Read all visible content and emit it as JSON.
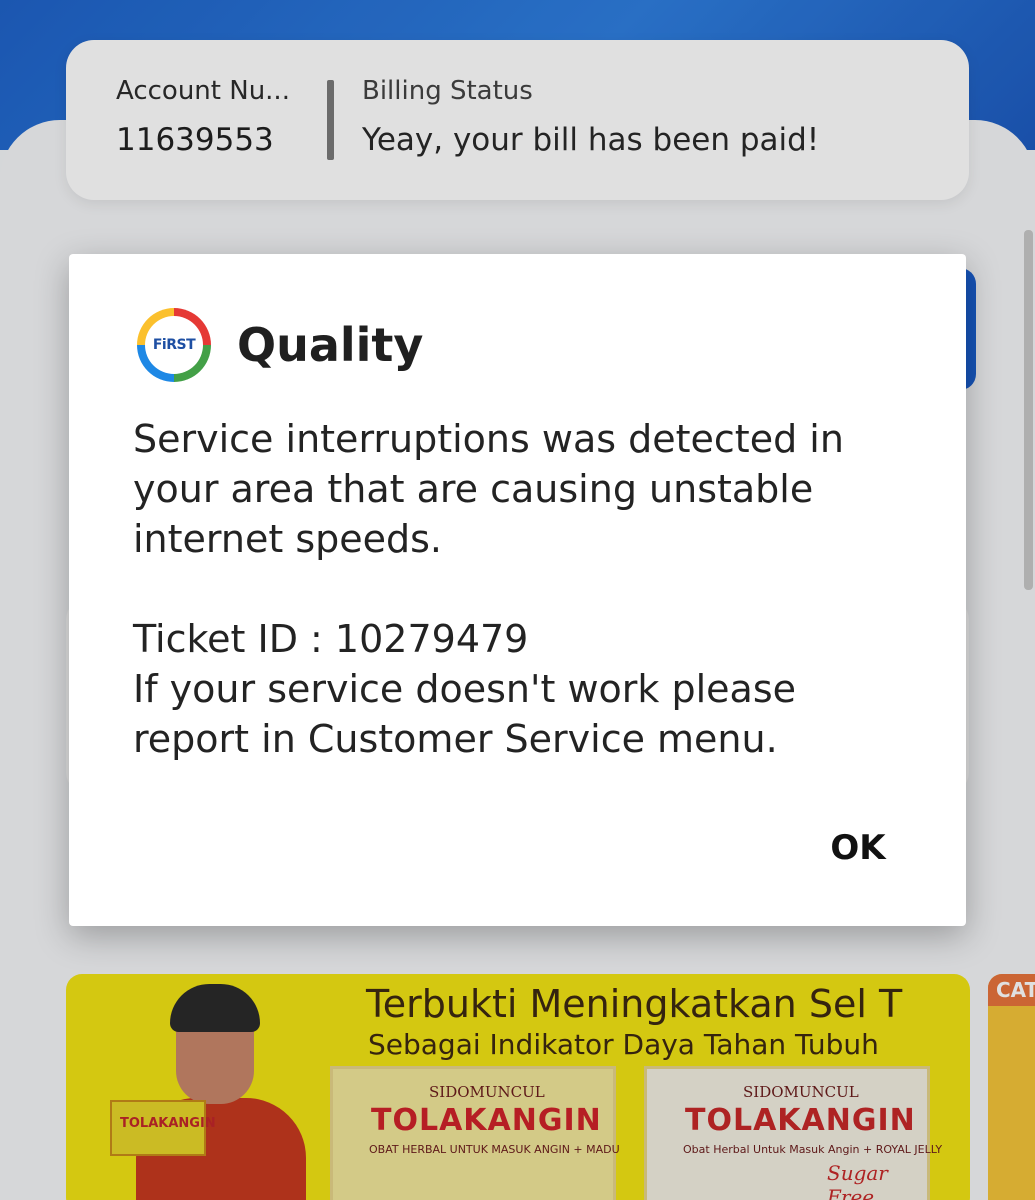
{
  "account": {
    "number_label": "Account Nu...",
    "number_value": "11639553",
    "billing_label": "Billing Status",
    "billing_value": "Yeay, your bill has been paid!"
  },
  "dialog": {
    "logo_text": "FiRST",
    "title": "Quality",
    "message": "Service interruptions was detected in your area that are causing unstable internet speeds.\n\nTicket ID : 10279479\nIf your service doesn't work please report in Customer Service menu.",
    "ok_label": "OK"
  },
  "banner": {
    "title": "Terbukti Meningkatkan Sel T",
    "subtitle": "Sebagai Indikator Daya Tahan Tubuh",
    "pack1": {
      "brand": "SIDOMUNCUL",
      "name": "TOLAKANGIN",
      "desc": "OBAT HERBAL UNTUK MASUK ANGIN + MADU"
    },
    "pack2": {
      "brand": "SIDOMUNCUL",
      "name": "TOLAKANGIN",
      "desc": "Obat Herbal Untuk Masuk Angin + ROYAL JELLY",
      "variant": "Sugar Free"
    },
    "hand_pack_text": "TOLAKANGIN",
    "side_tag": "CAT"
  },
  "colors": {
    "primary_blue": "#1f63c9",
    "banner_yellow": "#f2e414",
    "brand_red": "#d0232a"
  }
}
